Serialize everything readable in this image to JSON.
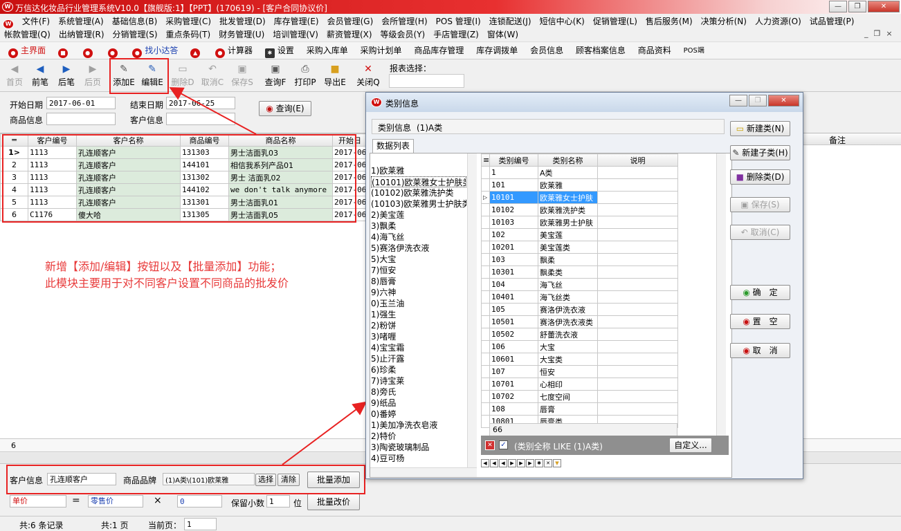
{
  "window": {
    "title": "万信达化妆品行业管理系统V10.0【旗舰版:1】【PPT】(170619) - [客户合同协议价]"
  },
  "menu1": [
    "文件(F)",
    "系统管理(A)",
    "基础信息(B)",
    "采购管理(C)",
    "批发管理(D)",
    "库存管理(E)",
    "会员管理(G)",
    "会所管理(H)",
    "POS 管理(I)",
    "连锁配送(J)",
    "短信中心(K)",
    "促销管理(L)",
    "售后服务(M)",
    "决策分析(N)",
    "人力资源(O)",
    "试品管理(P)"
  ],
  "menu2": [
    "帐款管理(Q)",
    "出纳管理(R)",
    "分销管理(S)",
    "重点条码(T)",
    "财务管理(U)",
    "培训管理(V)",
    "薪资管理(X)",
    "等级会员(Y)",
    "手店管理(Z)",
    "窗体(W)"
  ],
  "toolbar2": [
    "主界面",
    "找小达答",
    "计算器",
    "设置",
    "采购入库单",
    "采购计划单",
    "商品库存管理",
    "库存调拨单",
    "会员信息",
    "顾客档案信息",
    "商品资料",
    "POS端"
  ],
  "toolbar3": {
    "first": "首页",
    "prev": "前笔",
    "next": "后笔",
    "last": "后页",
    "add": "添加E",
    "edit": "编辑E",
    "delete": "删除D",
    "cancel": "取消C",
    "save": "保存S",
    "query": "查询F",
    "print": "打印P",
    "export": "导出E",
    "close": "关闭Q",
    "report_label": "报表选择："
  },
  "filter": {
    "start_label": "开始日期",
    "start_value": "2017-06-01",
    "end_label": "结束日期",
    "end_value": "2017-06-25",
    "product_label": "商品信息",
    "customer_label": "客户信息",
    "query_button": "查询(E)"
  },
  "grid": {
    "headers": [
      "客户编号",
      "客户名称",
      "商品编号",
      "商品名称",
      "开始日"
    ],
    "note_header": "备注",
    "rows": [
      {
        "no": "1",
        "code": "1113",
        "name": "孔连顺客户",
        "pcode": "131303",
        "pname": "男士洁面乳03",
        "date": "2017-06"
      },
      {
        "no": "2",
        "code": "1113",
        "name": "孔连顺客户",
        "pcode": "144101",
        "pname": "相信我系列产品01",
        "date": "2017-06"
      },
      {
        "no": "3",
        "code": "1113",
        "name": "孔连顺客户",
        "pcode": "131302",
        "pname": "男士 洁面乳02",
        "date": "2017-06"
      },
      {
        "no": "4",
        "code": "1113",
        "name": "孔连顺客户",
        "pcode": "144102",
        "pname": "we don't talk anymore",
        "date": "2017-06"
      },
      {
        "no": "5",
        "code": "1113",
        "name": "孔连顺客户",
        "pcode": "131301",
        "pname": "男士洁面乳01",
        "date": "2017-06"
      },
      {
        "no": "6",
        "code": "C1176",
        "name": "傻大哈",
        "pcode": "131305",
        "pname": "男士洁面乳05",
        "date": "2017-06"
      }
    ],
    "footer_count": "6"
  },
  "annotation": {
    "line1": "新增【添加/编辑】按钮以及【批量添加】功能；",
    "line2": "此模块主要用于对不同客户设置不同商品的批发价"
  },
  "bottom": {
    "customer_label": "客户信息",
    "customer_value": "孔连顺客户",
    "brand_label": "商品品牌",
    "brand_value": "(1)A类\\(101)欧莱雅",
    "choose": "选择",
    "clear": "清除",
    "batch_add": "批量添加",
    "price_from": "单价",
    "equals": "=",
    "price_to": "零售价",
    "times": "×",
    "factor": "0",
    "decimals_label": "保留小数",
    "decimals_value": "1",
    "decimals_unit": "位",
    "batch_edit": "批量改价"
  },
  "status": {
    "records": "共:6 条记录",
    "pages": "共:1 页",
    "current_label": "当前页：",
    "current_value": "1"
  },
  "dialog": {
    "title": "类别信息",
    "info_label": "类别信息",
    "info_value": "(1)A类",
    "tab": "数据列表",
    "tree": [
      "1)欧莱雅",
      "(10101)欧莱雅女士护肤类",
      "(10102)欧莱雅洗护类",
      "(10103)欧莱雅男士护肤类",
      "2)美宝莲",
      "3)飘柔",
      "4)海飞丝",
      "5)赛洛伊洗衣液",
      "5)大宝",
      "7)恒安",
      "8)唇膏",
      "9)六神",
      "0)玉兰油",
      "1)强生",
      "2)粉饼",
      "3)啫喱",
      "4)宝宝霜",
      "5)止汗露",
      "6)珍柔",
      "7)诗宝莱",
      "8)旁氏",
      "9)纸品",
      "0)番婷",
      "1)美加净洗衣皂液",
      "2)特价",
      "3)陶瓷玻璃制品",
      "4)豆可杨"
    ],
    "grid_headers": [
      "类别编号",
      "类别名称",
      "说明"
    ],
    "grid_rows": [
      {
        "code": "1",
        "name": "A类"
      },
      {
        "code": "101",
        "name": "欧莱雅"
      },
      {
        "code": "10101",
        "name": "欧莱雅女士护肤"
      },
      {
        "code": "10102",
        "name": "欧莱雅洗护类"
      },
      {
        "code": "10103",
        "name": "欧莱雅男士护肤"
      },
      {
        "code": "102",
        "name": "美宝莲"
      },
      {
        "code": "10201",
        "name": "美宝莲类"
      },
      {
        "code": "103",
        "name": "飘柔"
      },
      {
        "code": "10301",
        "name": "飘柔类"
      },
      {
        "code": "104",
        "name": "海飞丝"
      },
      {
        "code": "10401",
        "name": "海飞丝类"
      },
      {
        "code": "105",
        "name": "赛洛伊洗衣液"
      },
      {
        "code": "10501",
        "name": "赛洛伊洗衣液类"
      },
      {
        "code": "10502",
        "name": "舒蕾洗衣液"
      },
      {
        "code": "106",
        "name": "大宝"
      },
      {
        "code": "10601",
        "name": "大宝类"
      },
      {
        "code": "107",
        "name": "恒安"
      },
      {
        "code": "10701",
        "name": "心相印"
      },
      {
        "code": "10702",
        "name": "七度空间"
      },
      {
        "code": "108",
        "name": "唇膏"
      },
      {
        "code": "10801",
        "name": "唇膏类"
      }
    ],
    "grid_count": "66",
    "filter_text": "(类别全称 LIKE (1)A类)",
    "custom_button": "自定义...",
    "buttons": {
      "new_category": "新建类(N)",
      "new_sub": "新建子类(H)",
      "delete": "删除类(D)",
      "save": "保存(S)",
      "cancel": "取消(C)",
      "ok": "确　定",
      "clear": "置　空",
      "cancel2": "取　消"
    }
  }
}
